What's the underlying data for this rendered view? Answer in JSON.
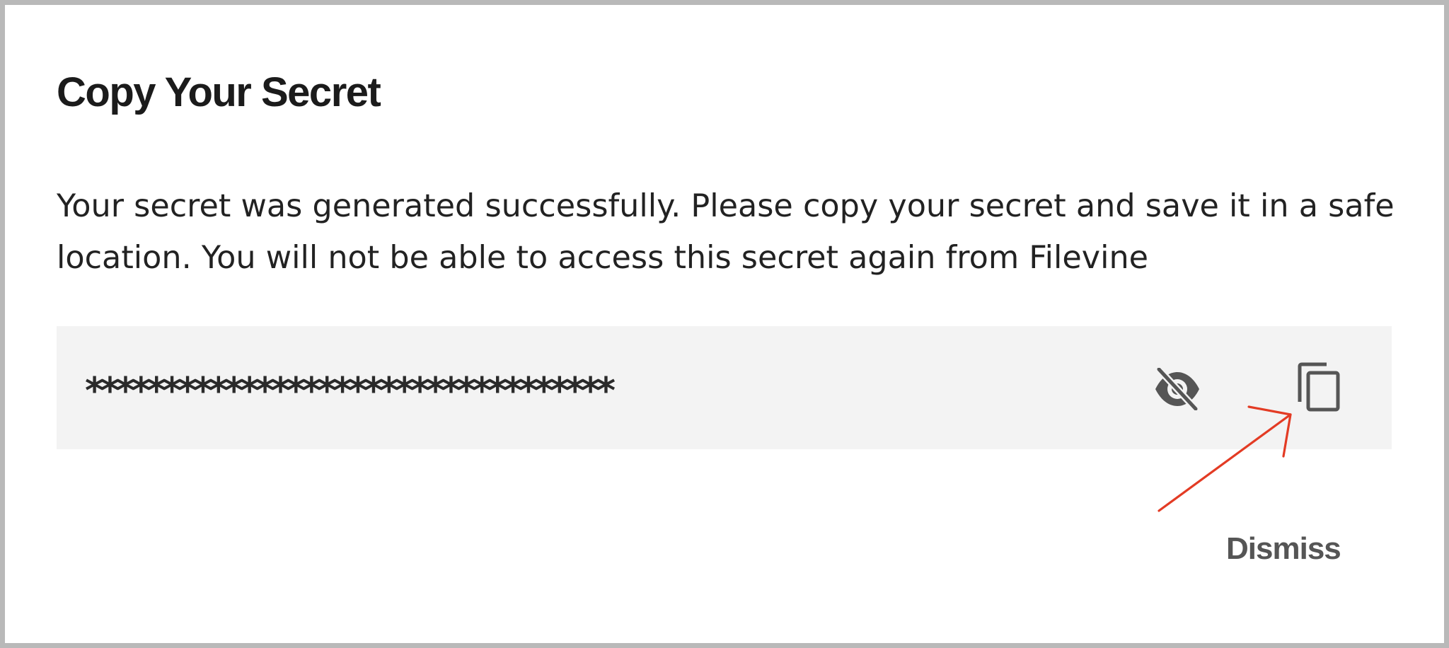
{
  "dialog": {
    "title": "Copy Your Secret",
    "message": "Your secret was generated successfully. Please copy your secret and save it in a safe location. You will not be able to access this secret again from Filevine",
    "secret": {
      "masked_value": "**********************************"
    },
    "dismiss_label": "Dismiss"
  },
  "icons": {
    "visibility": "visibility-off-icon",
    "copy": "copy-icon"
  },
  "colors": {
    "annotation_arrow": "#e33b24",
    "secret_box_background": "#f3f3f3",
    "icon": "#555555"
  }
}
